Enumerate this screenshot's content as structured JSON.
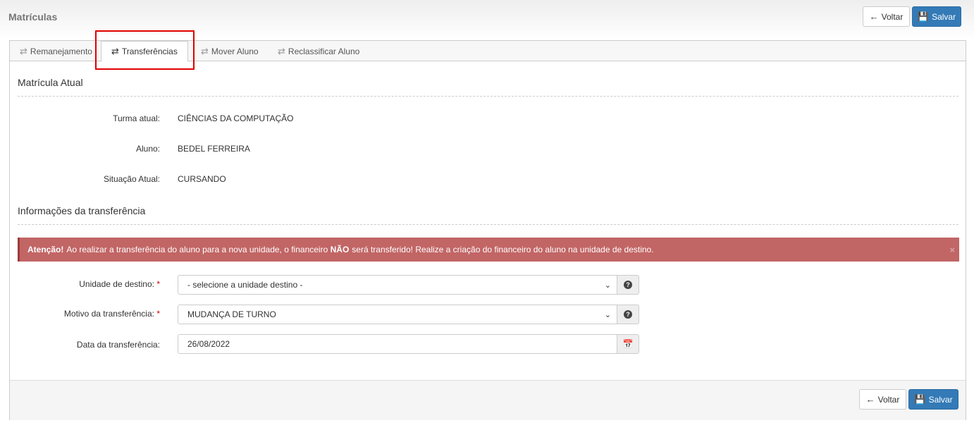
{
  "header": {
    "title": "Matrículas",
    "back_label": "Voltar",
    "save_label": "Salvar"
  },
  "tabs": [
    {
      "label": "Remanejamento",
      "icon": "exchange-icon"
    },
    {
      "label": "Transferências",
      "icon": "exchange-icon",
      "active": true
    },
    {
      "label": "Mover Aluno",
      "icon": "exchange-icon"
    },
    {
      "label": "Reclassificar Aluno",
      "icon": "exchange-icon"
    }
  ],
  "current": {
    "section_title": "Matrícula Atual",
    "turma_label": "Turma atual:",
    "turma_value": "CIÊNCIAS DA COMPUTAÇÃO",
    "aluno_label": "Aluno:",
    "aluno_value": "BEDEL FERREIRA",
    "situacao_label": "Situação Atual:",
    "situacao_value": "CURSANDO"
  },
  "transfer": {
    "section_title": "Informações da transferência",
    "alert_strong": "Atenção!",
    "alert_text1": "Ao realizar a transferência do aluno para a nova unidade, o financeiro",
    "alert_nao": "NÃO",
    "alert_text2": "será transferido! Realize a criação do financeiro do aluno na unidade de destino.",
    "alert_close": "×",
    "unidade_label": "Unidade de destino:",
    "unidade_value": "- selecione a unidade destino -",
    "motivo_label": "Motivo da transferência:",
    "motivo_value": "MUDANÇA DE TURNO",
    "data_label": "Data da transferência:",
    "data_value": "26/08/2022",
    "required_mark": "*"
  },
  "footer": {
    "back_label": "Voltar",
    "save_label": "Salvar"
  },
  "colors": {
    "primary": "#337ab7",
    "alert_bg": "#c26565",
    "highlight": "#e00000"
  }
}
